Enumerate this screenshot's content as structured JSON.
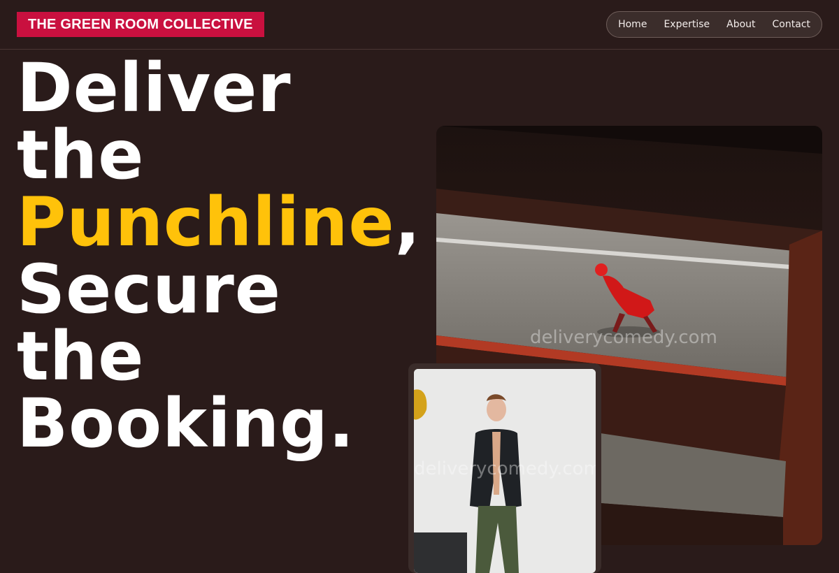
{
  "brand": {
    "name": "THE GREEN ROOM COLLECTIVE"
  },
  "nav": {
    "items": [
      "Home",
      "Expertise",
      "About",
      "Contact"
    ]
  },
  "hero": {
    "line1": "Deliver",
    "line2": "the",
    "line3_accent": "Punchline",
    "line3_rest": ",",
    "line4": "Secure",
    "line5": "the",
    "line6": "Booking."
  },
  "images": {
    "main_watermark": "deliverycomedy.com",
    "small_watermark": "deliverycomedy.com"
  },
  "colors": {
    "background": "#2a1b1a",
    "brand_red": "#c9103f",
    "accent_yellow": "#ffc20a",
    "text": "#ffffff"
  }
}
